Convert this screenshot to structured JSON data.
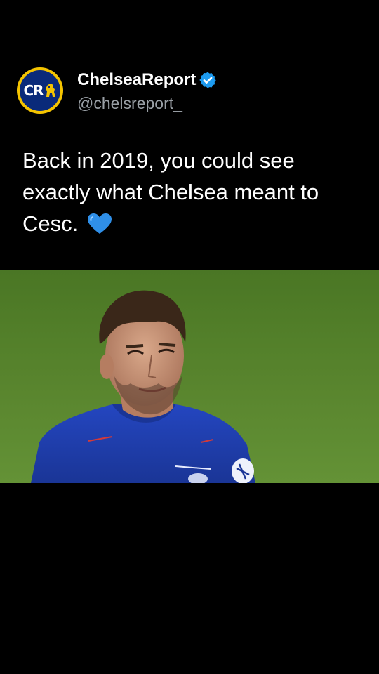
{
  "account": {
    "display_name": "ChelseaReport",
    "handle": "@chelsreport_",
    "avatar_text": "CR",
    "verified": true,
    "verified_color": "#1d9bf0"
  },
  "tweet": {
    "text": "Back in 2019, you could see exactly what Chelsea meant to Cesc.",
    "emoji": "blue-heart-icon"
  },
  "media": {
    "type": "photo",
    "subject": "player-photo"
  },
  "colors": {
    "background": "#000000",
    "text": "#ffffff",
    "handle": "#9aa0a6",
    "avatar_ring": "#f5c400",
    "avatar_fill": "#0a2a7a",
    "pitch": "#5d8a2f",
    "kit": "#1f3fb4"
  }
}
